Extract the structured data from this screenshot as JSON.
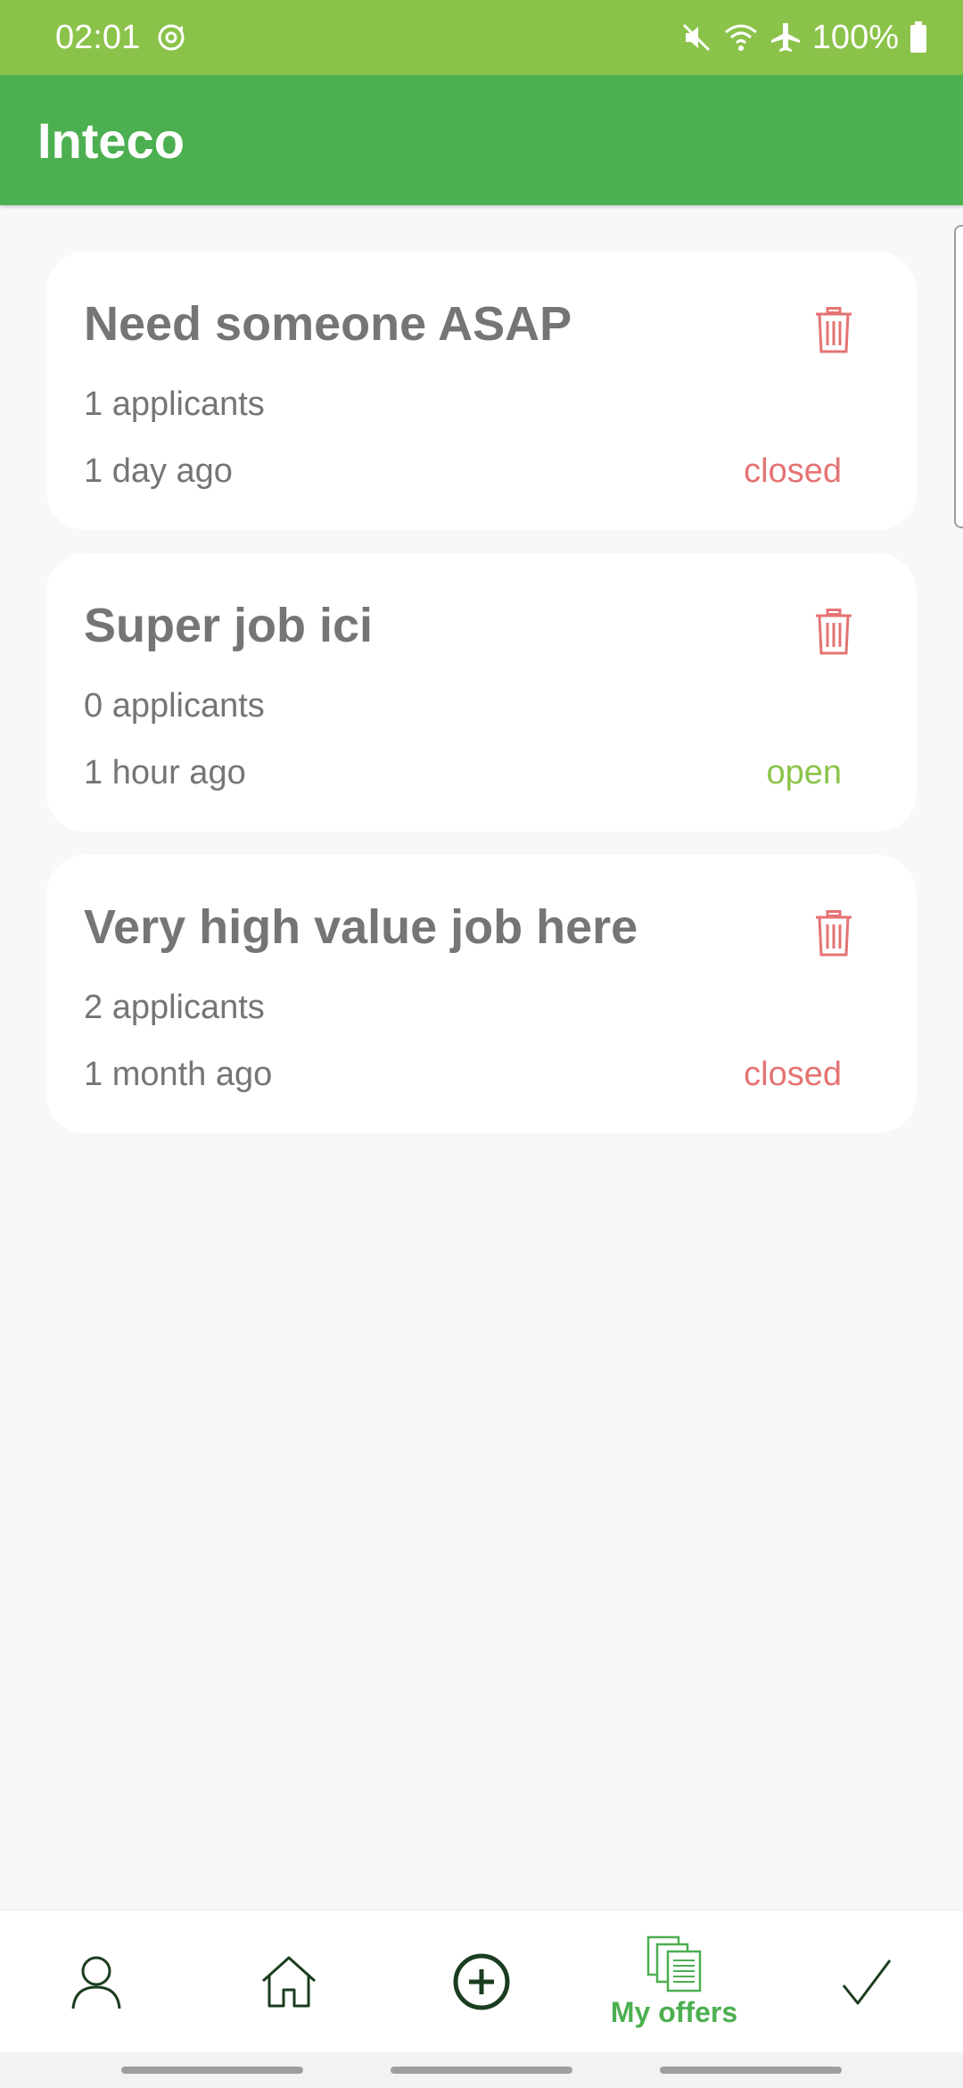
{
  "status_bar": {
    "time": "02:01",
    "battery": "100%",
    "icons": [
      "sync-icon",
      "mute-icon",
      "wifi-icon",
      "airplane-icon",
      "battery-icon"
    ]
  },
  "app_bar": {
    "title": "Inteco"
  },
  "offers": [
    {
      "title": "Need someone ASAP",
      "applicants": "1 applicants",
      "time": "1 day ago",
      "status": "closed"
    },
    {
      "title": "Super job ici",
      "applicants": "0 applicants",
      "time": "1 hour ago",
      "status": "open"
    },
    {
      "title": "Very high value job here",
      "applicants": "2 applicants",
      "time": "1 month ago",
      "status": "closed"
    }
  ],
  "bottom_nav": {
    "items": [
      {
        "icon": "profile-icon"
      },
      {
        "icon": "home-icon"
      },
      {
        "icon": "add-circle-icon"
      },
      {
        "icon": "documents-icon",
        "label": "My offers",
        "active": true
      },
      {
        "icon": "checkmark-icon"
      }
    ]
  },
  "colors": {
    "status_bar": "#8bc34a",
    "app_bar": "#4caf50",
    "closed": "#e57373",
    "open": "#8bc34a",
    "text_gray": "#757575"
  }
}
